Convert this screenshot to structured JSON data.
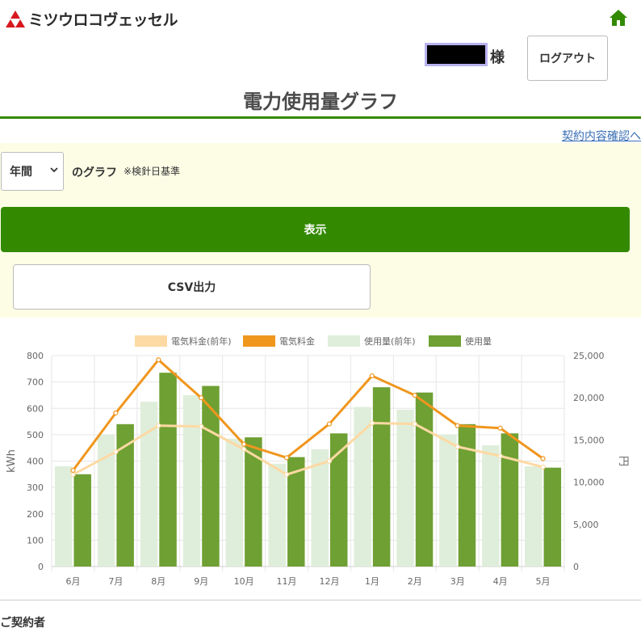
{
  "header": {
    "logo_text": "ミツウロコヴェッセル",
    "user_suffix": "様",
    "logout_label": "ログアウト"
  },
  "page": {
    "title": "電力使用量グラフ",
    "contract_link": "契約内容確認へ"
  },
  "form": {
    "period_options": [
      "年間"
    ],
    "period_selected": "年間",
    "graph_label": "のグラフ",
    "basis_note": "※検針日基準",
    "show_label": "表示",
    "csv_label": "CSV出力"
  },
  "footer": {
    "contractor_heading": "ご契約者"
  },
  "colors": {
    "brand_green": "#338a00",
    "usage": "#6fa033",
    "usage_prev": "#dfeeda",
    "fee": "#f0961d",
    "fee_prev": "#fdd9a3",
    "logo_red": "#d7181f"
  },
  "chart_data": {
    "type": "bar",
    "categories": [
      "6月",
      "7月",
      "8月",
      "9月",
      "10月",
      "11月",
      "12月",
      "1月",
      "2月",
      "3月",
      "4月",
      "5月"
    ],
    "series": [
      {
        "name": "使用量(前年)",
        "type": "bar",
        "axis": "left",
        "values": [
          380,
          500,
          625,
          650,
          485,
          390,
          445,
          605,
          595,
          500,
          460,
          380
        ]
      },
      {
        "name": "使用量",
        "type": "bar",
        "axis": "left",
        "values": [
          350,
          540,
          735,
          685,
          490,
          415,
          505,
          680,
          660,
          540,
          505,
          375
        ]
      },
      {
        "name": "電気料金(前年)",
        "type": "line",
        "axis": "right",
        "values": [
          10900,
          13600,
          16700,
          16600,
          13900,
          10900,
          12500,
          17000,
          16900,
          14200,
          13100,
          11800
        ]
      },
      {
        "name": "電気料金",
        "type": "line",
        "axis": "right",
        "values": [
          11400,
          18200,
          24500,
          20000,
          14500,
          12900,
          16900,
          22600,
          20300,
          16700,
          16400,
          12800
        ]
      }
    ],
    "legend_order": [
      "電気料金(前年)",
      "電気料金",
      "使用量(前年)",
      "使用量"
    ],
    "legend_position": "top",
    "ylabel": "kWh",
    "y2label": "円",
    "ylim": [
      0,
      800
    ],
    "y2lim": [
      0,
      25000
    ],
    "y_ticks": [
      "0",
      "100",
      "200",
      "300",
      "400",
      "500",
      "600",
      "700",
      "800"
    ],
    "y2_ticks": [
      "0",
      "5,000",
      "10,000",
      "15,000",
      "20,000",
      "25,000"
    ],
    "grid": true
  }
}
